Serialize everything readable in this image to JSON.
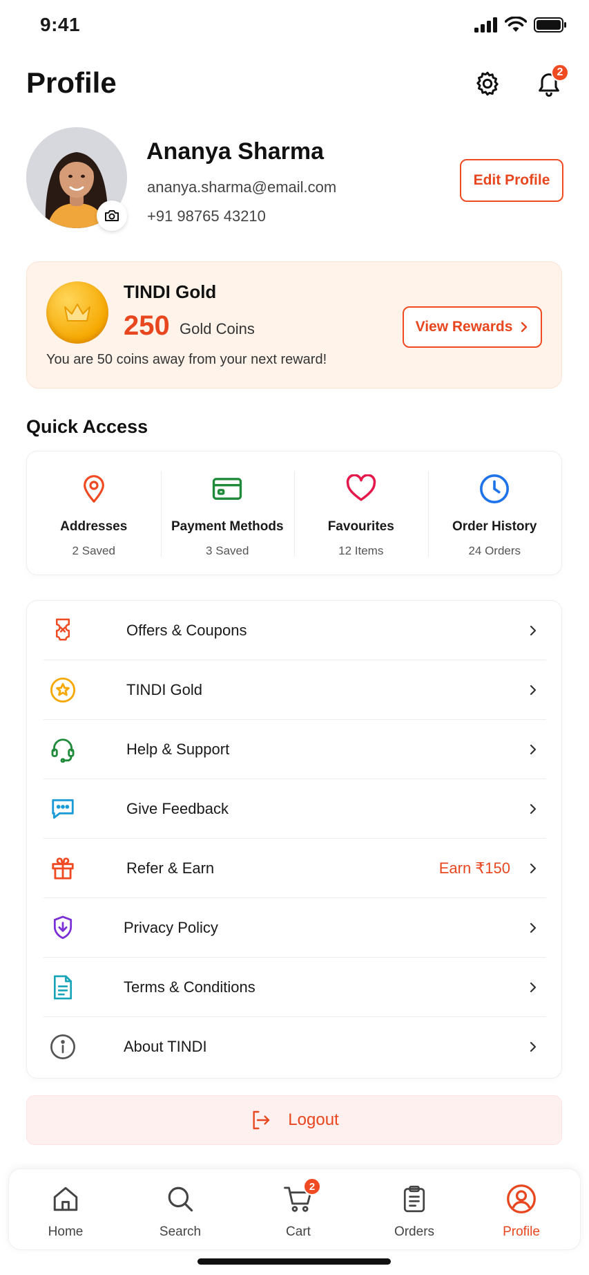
{
  "status_bar": {
    "time": "9:41"
  },
  "header": {
    "title": "Profile",
    "notification_count": "2"
  },
  "profile": {
    "name": "Ananya Sharma",
    "email": "ananya.sharma@email.com",
    "phone": "+91 98765 43210",
    "edit_label": "Edit Profile"
  },
  "gold": {
    "title": "TINDI Gold",
    "coins": "250",
    "unit": "Gold Coins",
    "note": "You are 50 coins away from your next reward!",
    "button_label": "View Rewards"
  },
  "quick_access": {
    "title": "Quick Access",
    "items": [
      {
        "label": "Addresses",
        "sub": "2 Saved",
        "icon": "map-pin-icon",
        "color": "#f04a23"
      },
      {
        "label": "Payment Methods",
        "sub": "3 Saved",
        "icon": "card-icon",
        "color": "#1e8a3a"
      },
      {
        "label": "Favourites",
        "sub": "12 Items",
        "icon": "heart-icon",
        "color": "#e5184b"
      },
      {
        "label": "Order History",
        "sub": "24 Orders",
        "icon": "clock-icon",
        "color": "#1f73e8"
      }
    ]
  },
  "menu": {
    "items": [
      {
        "label": "Offers & Coupons",
        "icon": "coupon-icon",
        "color": "#f04a23"
      },
      {
        "label": "TINDI Gold",
        "icon": "star-icon",
        "color": "#f6a800"
      },
      {
        "label": "Help & Support",
        "icon": "headset-icon",
        "color": "#1e8a3a"
      },
      {
        "label": "Give Feedback",
        "icon": "chat-icon",
        "color": "#1a9ad6"
      },
      {
        "label": "Refer & Earn",
        "icon": "gift-icon",
        "color": "#f04a23",
        "extra": "Earn ₹150"
      },
      {
        "label": "Privacy Policy",
        "icon": "shield-icon",
        "color": "#7b2fd6"
      },
      {
        "label": "Terms & Conditions",
        "icon": "document-icon",
        "color": "#14a3b8"
      },
      {
        "label": "About TINDI",
        "icon": "info-icon",
        "color": "#555555"
      }
    ]
  },
  "logout": {
    "label": "Logout"
  },
  "bottom_nav": {
    "items": [
      {
        "label": "Home",
        "icon": "home-icon"
      },
      {
        "label": "Search",
        "icon": "search-icon"
      },
      {
        "label": "Cart",
        "icon": "cart-icon",
        "badge": "2"
      },
      {
        "label": "Orders",
        "icon": "clipboard-icon"
      },
      {
        "label": "Profile",
        "icon": "user-circle-icon",
        "active": true
      }
    ]
  },
  "colors": {
    "accent": "#f04a23",
    "gold_bg": "#fff3ea",
    "logout_bg": "#fff0f0"
  }
}
